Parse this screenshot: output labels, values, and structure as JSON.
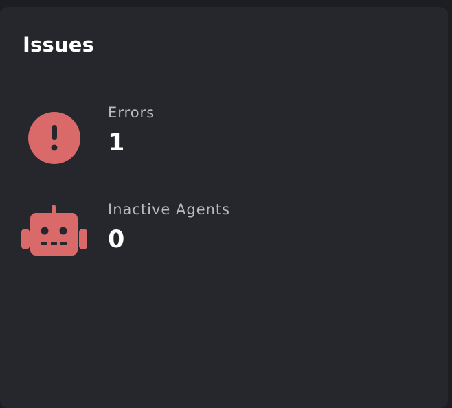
{
  "panel": {
    "title": "Issues"
  },
  "issues": [
    {
      "label": "Errors",
      "count": "1",
      "icon": "exclamation-circle-icon"
    },
    {
      "label": "Inactive Agents",
      "count": "0",
      "icon": "robot-icon"
    }
  ],
  "colors": {
    "background": "#1c1e22",
    "card": "#25272c",
    "accent": "#d96a69",
    "text": "#ffffff",
    "label": "#b8bac0"
  }
}
